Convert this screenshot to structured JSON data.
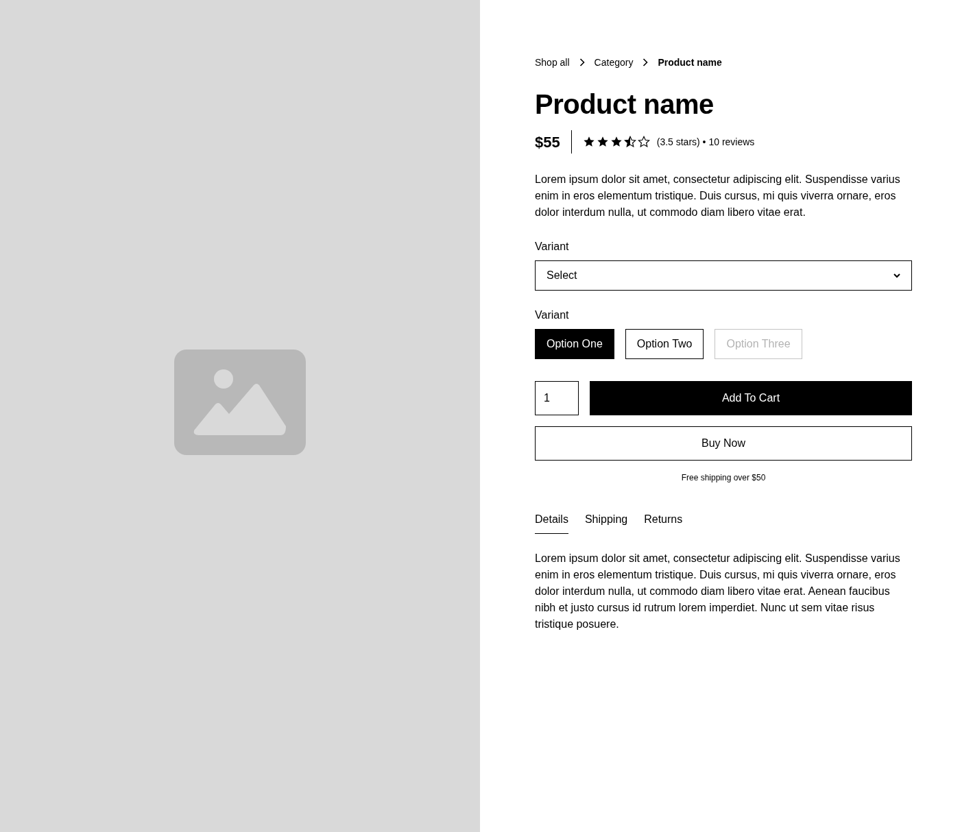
{
  "breadcrumb": [
    {
      "label": "Shop all",
      "current": false
    },
    {
      "label": "Category",
      "current": false
    },
    {
      "label": "Product name",
      "current": true
    }
  ],
  "title": "Product name",
  "price": "$55",
  "rating": {
    "stars": 3.5,
    "label": "(3.5 stars)",
    "separator": "•",
    "reviews": "10 reviews"
  },
  "description": "Lorem ipsum dolor sit amet, consectetur adipiscing elit. Suspendisse varius enim in eros elementum tristique. Duis cursus, mi quis viverra ornare, eros dolor interdum nulla, ut commodo diam libero vitae erat.",
  "variant_select": {
    "label": "Variant",
    "value": "Select"
  },
  "variant_options": {
    "label": "Variant",
    "options": [
      {
        "label": "Option One",
        "selected": true,
        "disabled": false
      },
      {
        "label": "Option Two",
        "selected": false,
        "disabled": false
      },
      {
        "label": "Option Three",
        "selected": false,
        "disabled": true
      }
    ]
  },
  "quantity": "1",
  "add_to_cart": "Add To Cart",
  "buy_now": "Buy Now",
  "shipping_note": "Free shipping over $50",
  "tabs": [
    {
      "label": "Details",
      "selected": true
    },
    {
      "label": "Shipping",
      "selected": false
    },
    {
      "label": "Returns",
      "selected": false
    }
  ],
  "tab_content": "Lorem ipsum dolor sit amet, consectetur adipiscing elit. Suspendisse varius enim in eros elementum tristique. Duis cursus, mi quis viverra ornare, eros dolor interdum nulla, ut commodo diam libero vitae erat. Aenean faucibus nibh et justo cursus id rutrum lorem imperdiet. Nunc ut sem vitae risus tristique posuere."
}
